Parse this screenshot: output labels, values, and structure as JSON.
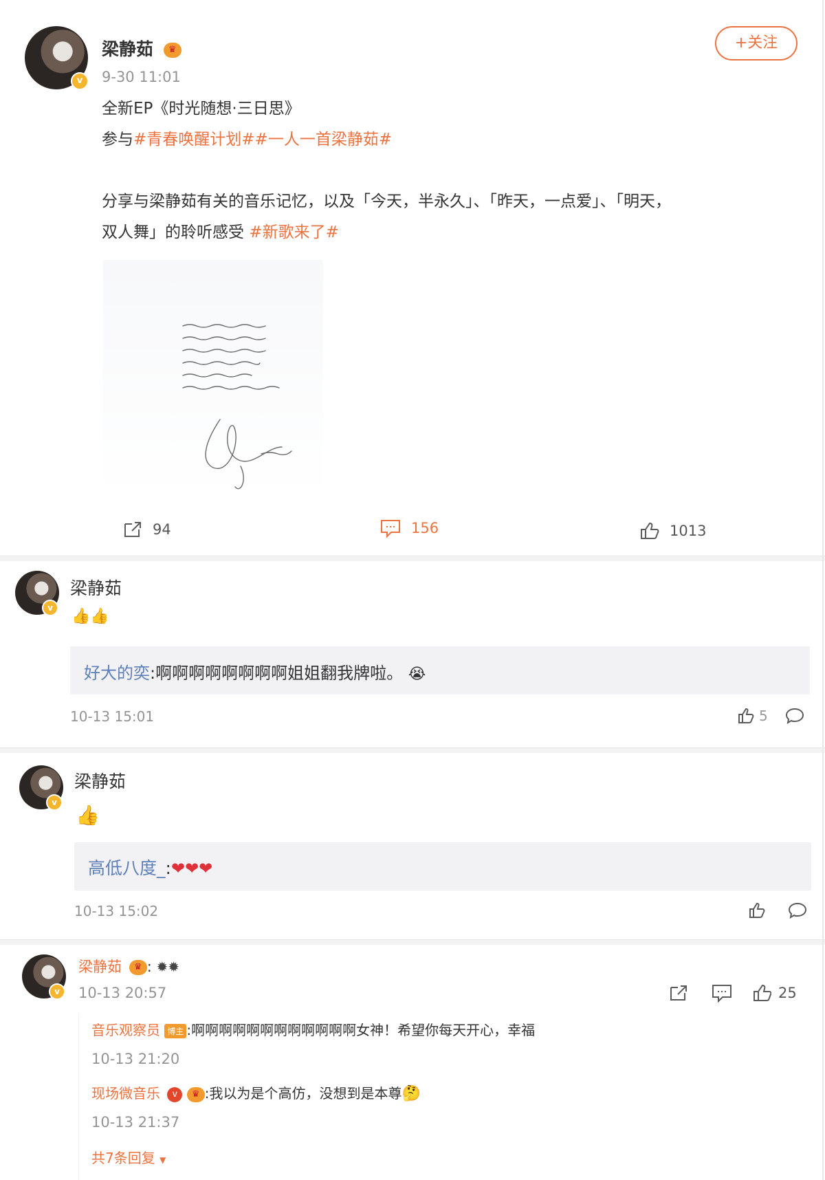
{
  "post": {
    "author": "梁静茹",
    "timestamp": "9-30 11:01",
    "follow_label": "+关注",
    "line1": "全新EP《时光随想·三日思》",
    "line2_prefix": "参与",
    "line2_tags": "#青春唤醒计划##一人一首梁静茹#",
    "line3": "分享与梁静茹有关的音乐记忆，以及「今天，半永久」、「昨天，一点爱」、「明天，",
    "line4": "双人舞」的聆听感受",
    "line4_tag": "#新歌来了#",
    "repost_count": "94",
    "comment_count": "156",
    "like_count": "1013"
  },
  "comment1": {
    "author": "梁静茹",
    "reply_nick": "好大的奕",
    "reply_text": ":啊啊啊啊啊啊啊啊姐姐翻我牌啦。",
    "timestamp": "10-13 15:01",
    "like_count": "5"
  },
  "comment2": {
    "author": "梁静茹",
    "reply_nick": "高低八度_",
    "reply_text": ":",
    "hearts": "❤❤❤",
    "timestamp": "10-13 15:02"
  },
  "comment3": {
    "author": "梁静茹",
    "timestamp": "10-13 20:57",
    "like_count": "25",
    "reply1_nick": "音乐观察员",
    "reply1_badge": "博主",
    "reply1_text": ":啊啊啊啊啊啊啊啊啊啊啊啊女神！希望你每天开心，幸福",
    "reply1_time": "10-13 21:20",
    "reply2_nick": "现场微音乐",
    "reply2_text": ":我以为是个高仿，没想到是本尊",
    "reply2_time": "10-13 21:37",
    "more_replies": "共7条回复"
  },
  "colors": {
    "accent_orange": "#eb7340",
    "nick_blue": "#5d7fb8",
    "verified_yellow": "#f5b52c",
    "heart_red": "#e0303a"
  }
}
